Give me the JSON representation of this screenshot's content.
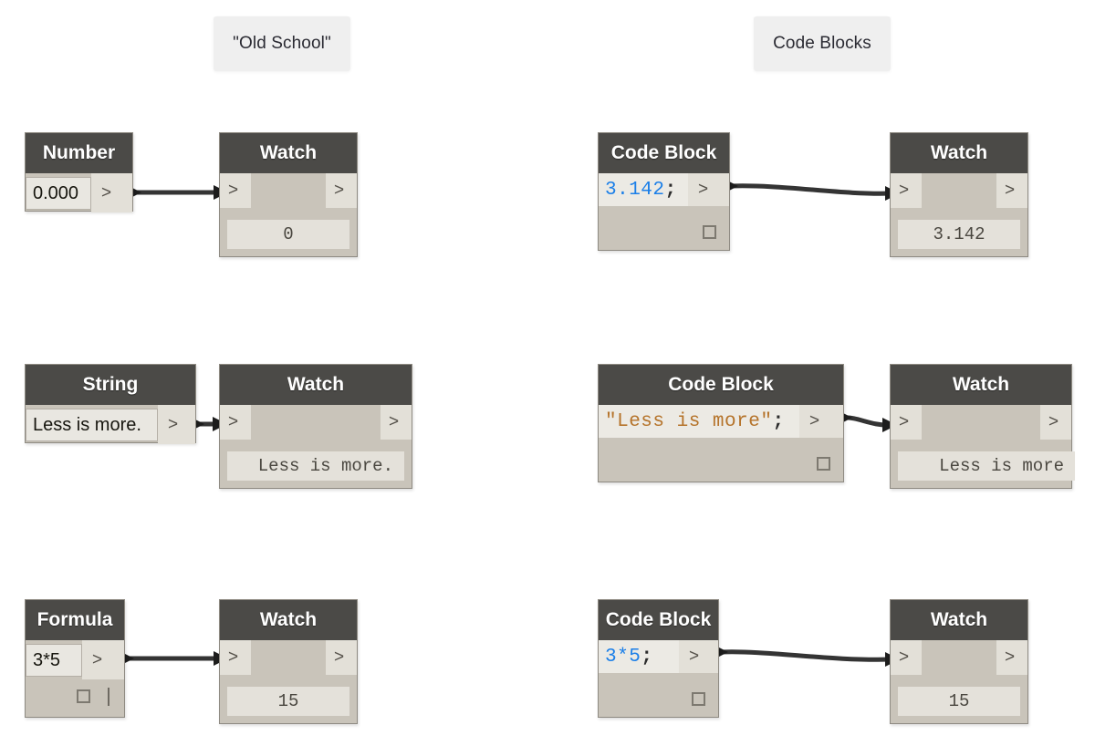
{
  "captions": [
    {
      "id": "old-school",
      "text": "\"Old School\""
    },
    {
      "id": "code-blocks",
      "text": "Code Blocks"
    }
  ],
  "port_glyph": ">",
  "rows": [
    {
      "id": "number-row",
      "source": {
        "title": "Number",
        "value": "0.000",
        "out_port": ">"
      },
      "watch": {
        "title": "Watch",
        "in_port": ">",
        "out_port": ">",
        "value": "0"
      },
      "codeblock": {
        "title": "Code Block",
        "code_literal": "3.142",
        "code_terminator": ";",
        "literal_kind": "number",
        "out_port": ">"
      },
      "codewatch": {
        "title": "Watch",
        "in_port": ">",
        "out_port": ">",
        "value": "3.142"
      }
    },
    {
      "id": "string-row",
      "source": {
        "title": "String",
        "value": "Less is more.",
        "out_port": ">"
      },
      "watch": {
        "title": "Watch",
        "in_port": ">",
        "out_port": ">",
        "value": "Less is more."
      },
      "codeblock": {
        "title": "Code Block",
        "code_literal": "\"Less is more\"",
        "code_terminator": ";",
        "literal_kind": "string",
        "out_port": ">"
      },
      "codewatch": {
        "title": "Watch",
        "in_port": ">",
        "out_port": ">",
        "value": "Less is more"
      }
    },
    {
      "id": "formula-row",
      "source": {
        "title": "Formula",
        "value": "3*5",
        "out_port": ">"
      },
      "watch": {
        "title": "Watch",
        "in_port": ">",
        "out_port": ">",
        "value": "15"
      },
      "codeblock": {
        "title": "Code Block",
        "code_literal": "3*5",
        "code_terminator": ";",
        "literal_kind": "number",
        "out_port": ">"
      },
      "codewatch": {
        "title": "Watch",
        "in_port": ">",
        "out_port": ">",
        "value": "15"
      }
    }
  ],
  "colors": {
    "canvas": "#ffffff",
    "node_body": "#c9c4ba",
    "node_header": "#4b4a47",
    "port": "#e3e0d8",
    "wire": "#343434",
    "number_literal": "#1b7fe8",
    "string_literal": "#b5732a",
    "caption_chip": "#efefef"
  }
}
